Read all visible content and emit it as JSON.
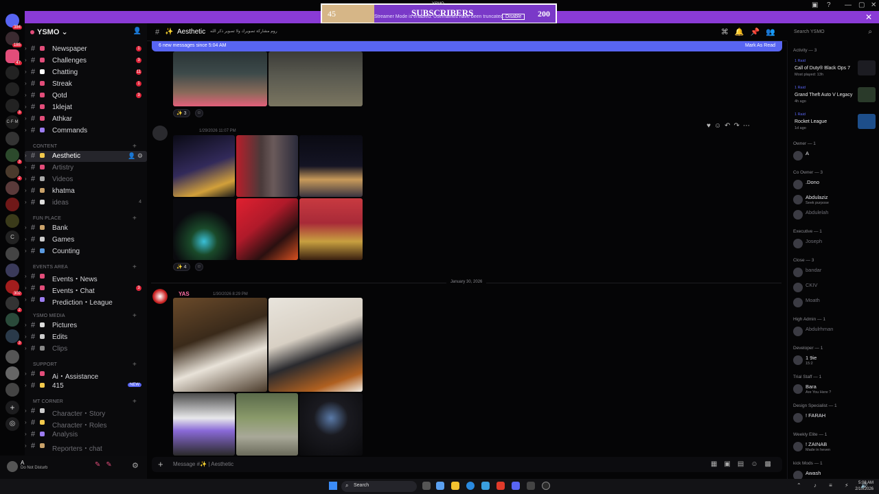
{
  "overlay": {
    "left_value": "45",
    "title": "SUBSCRIBERS",
    "subtitle": "Streamer Mode is enabled. Usernames have been truncated.",
    "disable_label": "Disable",
    "right_value": "200",
    "top_tag": "YSMO"
  },
  "server": {
    "name": "YSMO",
    "rail_badges": [
      "384",
      "185",
      "47",
      "3",
      "3",
      "2",
      "2",
      "3",
      "302"
    ]
  },
  "channels": [
    {
      "label": "Newspaper",
      "badge": "1",
      "color": "#e24d7a"
    },
    {
      "label": "Challenges",
      "badge": "3",
      "color": "#e24d7a"
    },
    {
      "label": "Chatting",
      "badge": "11",
      "color": "#ffffff"
    },
    {
      "label": "Streak",
      "badge": "1",
      "color": "#e24d7a"
    },
    {
      "label": "Qotd",
      "badge": "3",
      "color": "#e24d7a"
    },
    {
      "label": "1klejat",
      "badge": "",
      "color": "#e24d7a"
    },
    {
      "label": "Athkar",
      "badge": "",
      "color": "#e24d7a"
    },
    {
      "label": "Commands",
      "badge": "",
      "color": "#9c7cf0"
    }
  ],
  "categories": {
    "content": "CONTENT",
    "fun_place": "FUN PLACE",
    "events_area": "EVENTS AREA",
    "ysmo_media": "YSMO MEDIA",
    "support": "SUPPORT",
    "mt_corner": "MT CORNER"
  },
  "content_channels": [
    {
      "label": "Aesthetic",
      "state": "active"
    },
    {
      "label": "Artistry",
      "state": "muted"
    },
    {
      "label": "Videos",
      "state": "muted"
    },
    {
      "label": "khatma",
      "state": "normal"
    },
    {
      "label": "ideas",
      "state": "muted",
      "count": "4"
    }
  ],
  "fun_channels": [
    "Bank",
    "Games",
    "Counting"
  ],
  "event_channels": [
    {
      "label": "Events・News",
      "badge": ""
    },
    {
      "label": "Events・Chat",
      "badge": "3"
    },
    {
      "label": "Prediction・League",
      "badge": ""
    }
  ],
  "media_channels": [
    {
      "label": "Pictures",
      "state": "normal"
    },
    {
      "label": "Edits",
      "state": "normal"
    },
    {
      "label": "Clips",
      "state": "muted"
    }
  ],
  "support_channels": [
    {
      "label": "Ai・Assistance",
      "tag": ""
    },
    {
      "label": "415",
      "tag": "NEW"
    }
  ],
  "mt_channels": [
    "Character・Story",
    "Character・Roles",
    "Analysis",
    "Reporters・chat"
  ],
  "user": {
    "name": "A",
    "status": "Do Not Disturb"
  },
  "header": {
    "channel": "Aesthetic",
    "topic": "روم مشاركة تصويرك ولا تصوير ذكر الله"
  },
  "new_messages": {
    "text": "6 new messages since 5:04 AM",
    "mark_read": "Mark As Read"
  },
  "search_placeholder": "Search YSMO",
  "messages": [
    {
      "reaction_count": "3"
    },
    {
      "timestamp": "1/29/2026 11:07 PM",
      "reaction_count": "4"
    },
    {
      "divider": "January 30, 2026",
      "author": "YAS",
      "timestamp": "1/30/2026 8:29 PM"
    }
  ],
  "composer_placeholder": "Message #✨ | Aesthetic",
  "members": {
    "activity_header": "Activity — 3",
    "activities": [
      {
        "tag": "1 Raid",
        "game": "Call of Duty® Black Ops 7",
        "meta": "Most played: 13h",
        "color": "#1c1c22"
      },
      {
        "tag": "1 Raid",
        "game": "Grand Theft Auto V Legacy",
        "meta": "4h ago",
        "color": "#2a3a2a"
      },
      {
        "tag": "1 Raid",
        "game": "Rocket League",
        "meta": "1d ago",
        "color": "#1d4e8a"
      }
    ],
    "groups": [
      {
        "title": "Owner — 1",
        "rows": [
          {
            "name": "A",
            "sub": "",
            "dim": false
          }
        ]
      },
      {
        "title": "Co Owner — 3",
        "rows": [
          {
            "name": ".Dono",
            "sub": "",
            "dim": false
          },
          {
            "name": "Abdulaziz",
            "sub": "Seek purpose",
            "dim": false
          },
          {
            "name": "Abdulelah",
            "sub": "",
            "dim": true
          }
        ]
      },
      {
        "title": "Executive — 1",
        "rows": [
          {
            "name": "Joseph",
            "sub": "",
            "dim": true
          }
        ]
      },
      {
        "title": "Close — 3",
        "rows": [
          {
            "name": "bandar",
            "sub": "",
            "dim": true
          },
          {
            "name": "CKIV",
            "sub": "",
            "dim": true
          },
          {
            "name": "Moath",
            "sub": "",
            "dim": true
          }
        ]
      },
      {
        "title": "High Admin — 1",
        "rows": [
          {
            "name": "Abdulrhman",
            "sub": "",
            "dim": true
          }
        ]
      },
      {
        "title": "Developer — 1",
        "rows": [
          {
            "name": "1 9ie",
            "sub": "15:2",
            "dim": false
          }
        ]
      },
      {
        "title": "Trial Staff — 1",
        "rows": [
          {
            "name": "Bara",
            "sub": "Are You Here ?",
            "dim": false
          }
        ]
      },
      {
        "title": "Design Specialist — 1",
        "rows": [
          {
            "name": "! FARAH",
            "sub": "",
            "dim": false
          }
        ]
      },
      {
        "title": "Weekly Elite — 1",
        "rows": [
          {
            "name": "! ZAINAB",
            "sub": "Made in heven",
            "dim": false
          }
        ]
      },
      {
        "title": "kick Mods — 1",
        "rows": [
          {
            "name": "Awash",
            "sub": "",
            "dim": false
          }
        ]
      }
    ]
  },
  "taskbar": {
    "search_label": "Search",
    "time": "5:08 AM",
    "date": "2/10/2026"
  },
  "colors": {
    "accent": "#8a3bd6",
    "blurple": "#5865f2",
    "mention_red": "#e0253a",
    "author_pink": "#ff6fa5"
  }
}
